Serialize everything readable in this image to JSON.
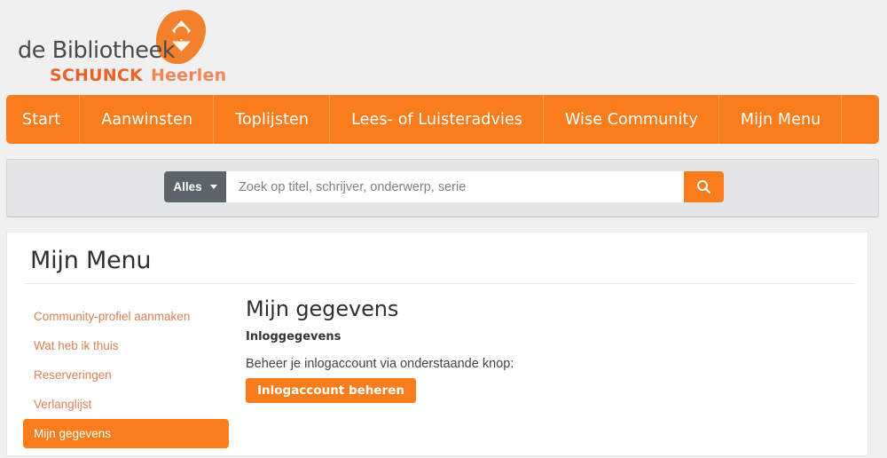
{
  "brand": {
    "name": "de Bibliotheek",
    "org": "SCHUNCK",
    "place": "Heerlen",
    "logo_icon": "bibliotheek-diamond-logo"
  },
  "nav": {
    "items": [
      {
        "label": "Start"
      },
      {
        "label": "Aanwinsten"
      },
      {
        "label": "Toplijsten"
      },
      {
        "label": "Lees- of Luisteradvies"
      },
      {
        "label": "Wise Community"
      },
      {
        "label": "Mijn Menu"
      }
    ]
  },
  "search": {
    "scope_label": "Alles",
    "scope_caret_icon": "chevron-down-icon",
    "placeholder": "Zoek op titel, schrijver, onderwerp, serie",
    "value": "",
    "submit_icon": "search-icon"
  },
  "page": {
    "title": "Mijn Menu"
  },
  "sidebar": {
    "items": [
      {
        "label": "Community-profiel aanmaken",
        "active": false
      },
      {
        "label": "Wat heb ik thuis",
        "active": false
      },
      {
        "label": "Reserveringen",
        "active": false
      },
      {
        "label": "Verlanglijst",
        "active": false
      },
      {
        "label": "Mijn gegevens",
        "active": true
      }
    ]
  },
  "main": {
    "heading": "Mijn gegevens",
    "section_heading": "Inloggegevens",
    "description": "Beheer je inlogaccount via onderstaande knop:",
    "button_label": "Inlogaccount beheren"
  },
  "colors": {
    "accent_orange": "#f97d1c",
    "brand_orange": "#e8622a",
    "brand_salmon": "#f0865a",
    "link_salmon": "#d98055",
    "scope_gray": "#5d6469",
    "page_bg": "#f0f0f0",
    "panel_gray": "#e3e5e6"
  }
}
